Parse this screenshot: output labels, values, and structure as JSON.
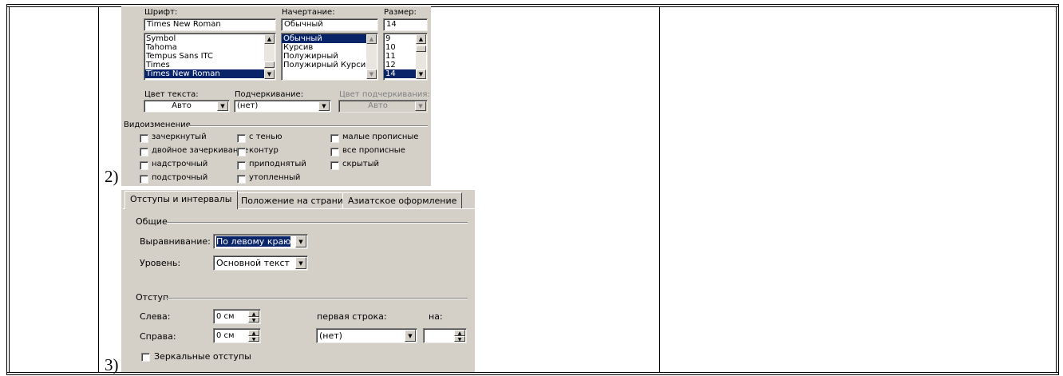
{
  "rows": [
    {
      "number": "2)"
    },
    {
      "number": "3)"
    }
  ],
  "font_dialog": {
    "font_label": "Шрифт:",
    "font_value": "Times New Roman",
    "fonts": [
      "Symbol",
      "Tahoma",
      "Tempus Sans ITC",
      "Times",
      "Times New Roman"
    ],
    "selected_font": "Times New Roman",
    "style_label": "Начертание:",
    "style_value": "Обычный",
    "styles": [
      "Обычный",
      "Курсив",
      "Полужирный",
      "Полужирный Курсив"
    ],
    "selected_style": "Обычный",
    "size_label": "Размер:",
    "size_value": "14",
    "sizes": [
      "9",
      "10",
      "11",
      "12",
      "14"
    ],
    "selected_size": "14",
    "text_color_label": "Цвет текста:",
    "text_color_value": "Авто",
    "underline_label": "Подчеркивание:",
    "underline_value": "(нет)",
    "underline_color_label": "Цвет подчеркивания:",
    "underline_color_value": "Авто",
    "effects_label": "Видоизменение",
    "effects": [
      "зачеркнутый",
      "двойное зачеркивание",
      "надстрочный",
      "подстрочный",
      "с тенью",
      "контур",
      "приподнятый",
      "утопленный",
      "малые прописные",
      "все прописные",
      "скрытый"
    ]
  },
  "para_dialog": {
    "tabs": [
      "Отступы и интервалы",
      "Положение на странице",
      "Азиатское оформление"
    ],
    "general_label": "Общие",
    "alignment_label": "Выравнивание:",
    "alignment_value": "По левому краю",
    "level_label": "Уровень:",
    "level_value": "Основной текст",
    "indent_label": "Отступ",
    "left_label": "Слева:",
    "left_value": "0 см",
    "right_label": "Справа:",
    "right_value": "0 см",
    "first_line_label": "первая строка:",
    "first_line_value": "(нет)",
    "by_label": "на:",
    "by_value": "",
    "mirror_label": "Зеркальные отступы"
  },
  "colors": {
    "dialog_bg": "#d4d0c8",
    "selection": "#0a246a",
    "table_border": "#000000"
  }
}
